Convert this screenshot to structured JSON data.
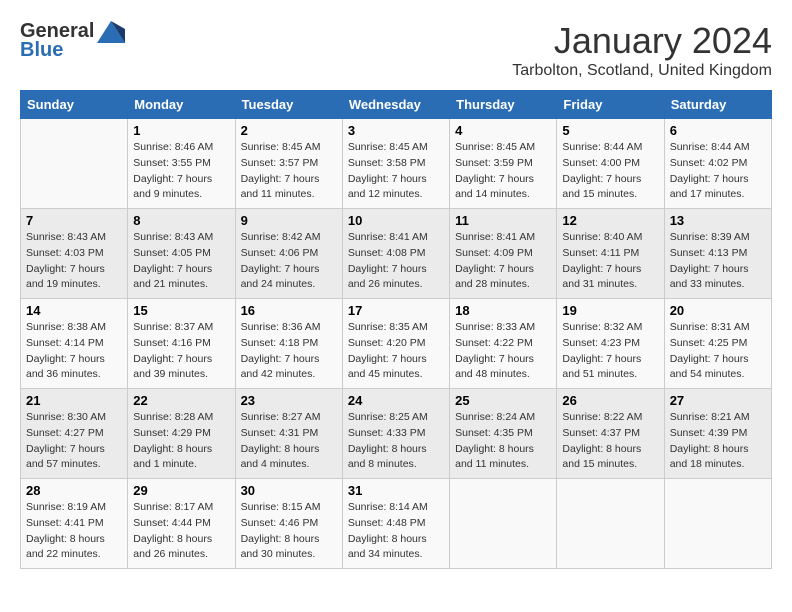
{
  "header": {
    "logo_general": "General",
    "logo_blue": "Blue",
    "month": "January 2024",
    "location": "Tarbolton, Scotland, United Kingdom"
  },
  "days_of_week": [
    "Sunday",
    "Monday",
    "Tuesday",
    "Wednesday",
    "Thursday",
    "Friday",
    "Saturday"
  ],
  "weeks": [
    [
      {
        "day": "",
        "sunrise": "",
        "sunset": "",
        "daylight": ""
      },
      {
        "day": "1",
        "sunrise": "Sunrise: 8:46 AM",
        "sunset": "Sunset: 3:55 PM",
        "daylight": "Daylight: 7 hours and 9 minutes."
      },
      {
        "day": "2",
        "sunrise": "Sunrise: 8:45 AM",
        "sunset": "Sunset: 3:57 PM",
        "daylight": "Daylight: 7 hours and 11 minutes."
      },
      {
        "day": "3",
        "sunrise": "Sunrise: 8:45 AM",
        "sunset": "Sunset: 3:58 PM",
        "daylight": "Daylight: 7 hours and 12 minutes."
      },
      {
        "day": "4",
        "sunrise": "Sunrise: 8:45 AM",
        "sunset": "Sunset: 3:59 PM",
        "daylight": "Daylight: 7 hours and 14 minutes."
      },
      {
        "day": "5",
        "sunrise": "Sunrise: 8:44 AM",
        "sunset": "Sunset: 4:00 PM",
        "daylight": "Daylight: 7 hours and 15 minutes."
      },
      {
        "day": "6",
        "sunrise": "Sunrise: 8:44 AM",
        "sunset": "Sunset: 4:02 PM",
        "daylight": "Daylight: 7 hours and 17 minutes."
      }
    ],
    [
      {
        "day": "7",
        "sunrise": "Sunrise: 8:43 AM",
        "sunset": "Sunset: 4:03 PM",
        "daylight": "Daylight: 7 hours and 19 minutes."
      },
      {
        "day": "8",
        "sunrise": "Sunrise: 8:43 AM",
        "sunset": "Sunset: 4:05 PM",
        "daylight": "Daylight: 7 hours and 21 minutes."
      },
      {
        "day": "9",
        "sunrise": "Sunrise: 8:42 AM",
        "sunset": "Sunset: 4:06 PM",
        "daylight": "Daylight: 7 hours and 24 minutes."
      },
      {
        "day": "10",
        "sunrise": "Sunrise: 8:41 AM",
        "sunset": "Sunset: 4:08 PM",
        "daylight": "Daylight: 7 hours and 26 minutes."
      },
      {
        "day": "11",
        "sunrise": "Sunrise: 8:41 AM",
        "sunset": "Sunset: 4:09 PM",
        "daylight": "Daylight: 7 hours and 28 minutes."
      },
      {
        "day": "12",
        "sunrise": "Sunrise: 8:40 AM",
        "sunset": "Sunset: 4:11 PM",
        "daylight": "Daylight: 7 hours and 31 minutes."
      },
      {
        "day": "13",
        "sunrise": "Sunrise: 8:39 AM",
        "sunset": "Sunset: 4:13 PM",
        "daylight": "Daylight: 7 hours and 33 minutes."
      }
    ],
    [
      {
        "day": "14",
        "sunrise": "Sunrise: 8:38 AM",
        "sunset": "Sunset: 4:14 PM",
        "daylight": "Daylight: 7 hours and 36 minutes."
      },
      {
        "day": "15",
        "sunrise": "Sunrise: 8:37 AM",
        "sunset": "Sunset: 4:16 PM",
        "daylight": "Daylight: 7 hours and 39 minutes."
      },
      {
        "day": "16",
        "sunrise": "Sunrise: 8:36 AM",
        "sunset": "Sunset: 4:18 PM",
        "daylight": "Daylight: 7 hours and 42 minutes."
      },
      {
        "day": "17",
        "sunrise": "Sunrise: 8:35 AM",
        "sunset": "Sunset: 4:20 PM",
        "daylight": "Daylight: 7 hours and 45 minutes."
      },
      {
        "day": "18",
        "sunrise": "Sunrise: 8:33 AM",
        "sunset": "Sunset: 4:22 PM",
        "daylight": "Daylight: 7 hours and 48 minutes."
      },
      {
        "day": "19",
        "sunrise": "Sunrise: 8:32 AM",
        "sunset": "Sunset: 4:23 PM",
        "daylight": "Daylight: 7 hours and 51 minutes."
      },
      {
        "day": "20",
        "sunrise": "Sunrise: 8:31 AM",
        "sunset": "Sunset: 4:25 PM",
        "daylight": "Daylight: 7 hours and 54 minutes."
      }
    ],
    [
      {
        "day": "21",
        "sunrise": "Sunrise: 8:30 AM",
        "sunset": "Sunset: 4:27 PM",
        "daylight": "Daylight: 7 hours and 57 minutes."
      },
      {
        "day": "22",
        "sunrise": "Sunrise: 8:28 AM",
        "sunset": "Sunset: 4:29 PM",
        "daylight": "Daylight: 8 hours and 1 minute."
      },
      {
        "day": "23",
        "sunrise": "Sunrise: 8:27 AM",
        "sunset": "Sunset: 4:31 PM",
        "daylight": "Daylight: 8 hours and 4 minutes."
      },
      {
        "day": "24",
        "sunrise": "Sunrise: 8:25 AM",
        "sunset": "Sunset: 4:33 PM",
        "daylight": "Daylight: 8 hours and 8 minutes."
      },
      {
        "day": "25",
        "sunrise": "Sunrise: 8:24 AM",
        "sunset": "Sunset: 4:35 PM",
        "daylight": "Daylight: 8 hours and 11 minutes."
      },
      {
        "day": "26",
        "sunrise": "Sunrise: 8:22 AM",
        "sunset": "Sunset: 4:37 PM",
        "daylight": "Daylight: 8 hours and 15 minutes."
      },
      {
        "day": "27",
        "sunrise": "Sunrise: 8:21 AM",
        "sunset": "Sunset: 4:39 PM",
        "daylight": "Daylight: 8 hours and 18 minutes."
      }
    ],
    [
      {
        "day": "28",
        "sunrise": "Sunrise: 8:19 AM",
        "sunset": "Sunset: 4:41 PM",
        "daylight": "Daylight: 8 hours and 22 minutes."
      },
      {
        "day": "29",
        "sunrise": "Sunrise: 8:17 AM",
        "sunset": "Sunset: 4:44 PM",
        "daylight": "Daylight: 8 hours and 26 minutes."
      },
      {
        "day": "30",
        "sunrise": "Sunrise: 8:15 AM",
        "sunset": "Sunset: 4:46 PM",
        "daylight": "Daylight: 8 hours and 30 minutes."
      },
      {
        "day": "31",
        "sunrise": "Sunrise: 8:14 AM",
        "sunset": "Sunset: 4:48 PM",
        "daylight": "Daylight: 8 hours and 34 minutes."
      },
      {
        "day": "",
        "sunrise": "",
        "sunset": "",
        "daylight": ""
      },
      {
        "day": "",
        "sunrise": "",
        "sunset": "",
        "daylight": ""
      },
      {
        "day": "",
        "sunrise": "",
        "sunset": "",
        "daylight": ""
      }
    ]
  ]
}
